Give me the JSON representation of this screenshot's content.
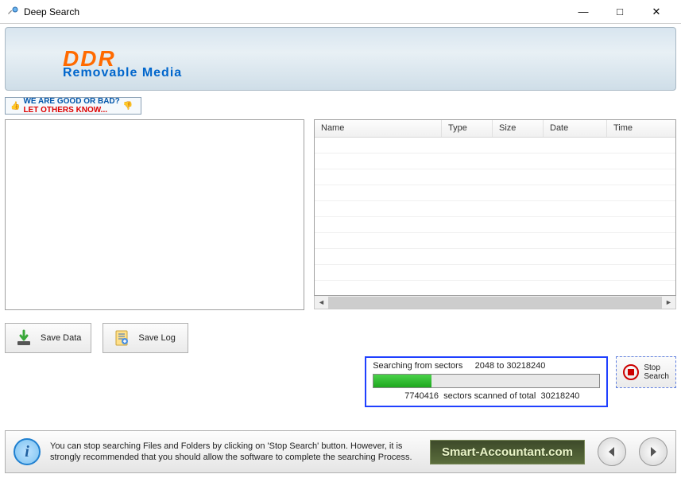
{
  "window": {
    "title": "Deep Search",
    "min": "—",
    "max": "□",
    "close": "✕"
  },
  "banner": {
    "brand": "DDR",
    "subtitle": "Removable Media"
  },
  "feedback": {
    "line1": "WE ARE GOOD OR BAD?",
    "line2": "LET OTHERS KNOW..."
  },
  "list": {
    "columns": [
      "Name",
      "Type",
      "Size",
      "Date",
      "Time"
    ]
  },
  "buttons": {
    "save_data": "Save Data",
    "save_log": "Save Log",
    "stop_line1": "Stop",
    "stop_line2": "Search"
  },
  "progress": {
    "label_prefix": "Searching from sectors",
    "range": "2048 to 30218240",
    "scanned": "7740416",
    "status_mid": "sectors scanned of total",
    "total": "30218240",
    "percent": 25.6
  },
  "footer": {
    "message": "You can stop searching Files and Folders by clicking on 'Stop Search' button. However, it is strongly recommended that you should allow the software to complete the searching Process.",
    "link": "Smart-Accountant.com"
  }
}
